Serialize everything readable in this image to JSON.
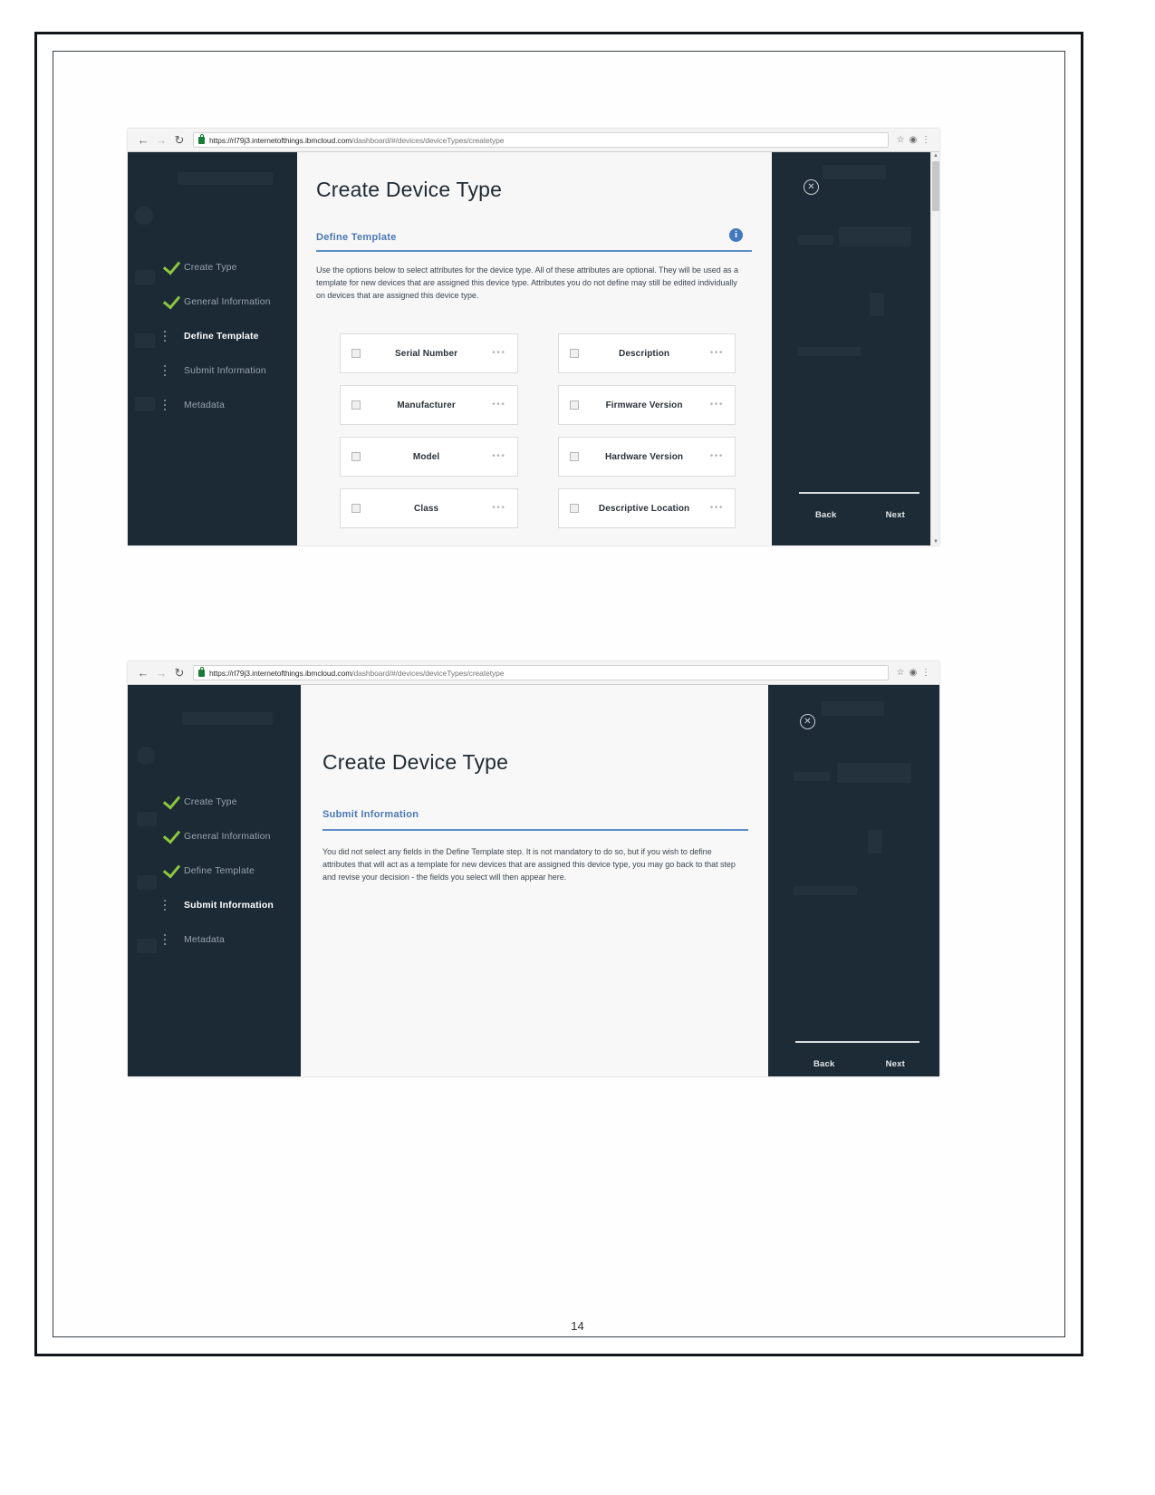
{
  "document": {
    "page_number": "14"
  },
  "browser": {
    "back_icon": "arrow-left-icon",
    "forward_icon": "arrow-right-icon",
    "reload_icon": "reload-icon",
    "lock_icon": "lock-icon",
    "url_scheme": "https://",
    "url_host": "rl79j3.internetofthings.ibmcloud.com",
    "url_path": "/dashboard/#/devices/deviceTypes/createtype",
    "star_icon": "star-icon",
    "profile_icon": "profile-icon",
    "menu_icon": "kebab-menu-icon"
  },
  "screenshot1": {
    "sidebar": {
      "steps": [
        {
          "label": "Create Type",
          "state": "complete",
          "marker": "check-icon"
        },
        {
          "label": "General Information",
          "state": "complete",
          "marker": "check-icon"
        },
        {
          "label": "Define Template",
          "state": "active",
          "marker": "dots-icon"
        },
        {
          "label": "Submit Information",
          "state": "pending",
          "marker": "dots-icon"
        },
        {
          "label": "Metadata",
          "state": "pending",
          "marker": "dots-icon"
        }
      ]
    },
    "main": {
      "title": "Create Device Type",
      "section_heading": "Define Template",
      "info_icon": "info-icon",
      "description": "Use the options below to select attributes for the device type. All of these attributes are optional. They will be used as a template for new devices that are assigned this device type. Attributes you do not define may still be edited individually on devices that are assigned this device type.",
      "attributes": [
        {
          "label": "Serial Number",
          "checked": false,
          "more": "•••"
        },
        {
          "label": "Description",
          "checked": false,
          "more": "•••"
        },
        {
          "label": "Manufacturer",
          "checked": false,
          "more": "•••"
        },
        {
          "label": "Firmware Version",
          "checked": false,
          "more": "•••"
        },
        {
          "label": "Model",
          "checked": false,
          "more": "•••"
        },
        {
          "label": "Hardware Version",
          "checked": false,
          "more": "•••"
        },
        {
          "label": "Class",
          "checked": false,
          "more": "•••"
        },
        {
          "label": "Descriptive Location",
          "checked": false,
          "more": "•••"
        }
      ]
    },
    "right": {
      "close_icon": "close-circle-icon",
      "back_label": "Back",
      "next_label": "Next"
    }
  },
  "screenshot2": {
    "sidebar": {
      "steps": [
        {
          "label": "Create Type",
          "state": "complete",
          "marker": "check-icon"
        },
        {
          "label": "General Information",
          "state": "complete",
          "marker": "check-icon"
        },
        {
          "label": "Define Template",
          "state": "complete",
          "marker": "check-icon"
        },
        {
          "label": "Submit Information",
          "state": "active",
          "marker": "dots-icon"
        },
        {
          "label": "Metadata",
          "state": "pending",
          "marker": "dots-icon"
        }
      ]
    },
    "main": {
      "title": "Create Device Type",
      "section_heading": "Submit Information",
      "description": "You did not select any fields in the Define Template step. It is not mandatory to do so, but if you wish to define attributes that will act as a template for new devices that are assigned this device type, you may go back to that step and revise your decision - the fields you select will then appear here."
    },
    "right": {
      "close_icon": "close-circle-icon",
      "back_label": "Back",
      "next_label": "Next"
    }
  },
  "colors": {
    "sidebar_bg": "#1d2b36",
    "accent_blue": "#4a78b5",
    "check_green": "#8ec63f",
    "info_blue": "#4178be"
  }
}
